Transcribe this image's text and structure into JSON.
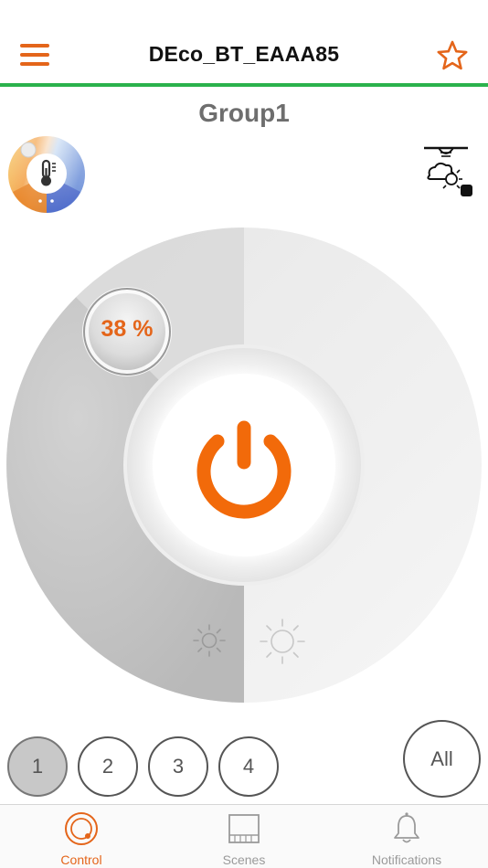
{
  "header": {
    "title": "DEco_BT_EAAA85",
    "menu_icon": "hamburger-menu-icon",
    "favorite_icon": "star-outline-icon",
    "accent_color": "#e4651a",
    "divider_color": "#2bb24c"
  },
  "group": {
    "name": "Group1"
  },
  "controls": {
    "color_temp_icon": "thermometer-icon",
    "sensor_icon": "daylight-sensor-icon"
  },
  "dial": {
    "level_label": "38 %",
    "level_percent": 38,
    "power_icon": "power-icon",
    "dim_icon": "sun-small-icon",
    "bright_icon": "sun-large-icon"
  },
  "channels": {
    "items": [
      "1",
      "2",
      "3",
      "4"
    ],
    "selected": "1",
    "all_label": "All"
  },
  "tabs": [
    {
      "label": "Control",
      "icon": "control-dial-icon",
      "active": true
    },
    {
      "label": "Scenes",
      "icon": "scenes-grid-icon",
      "active": false
    },
    {
      "label": "Notifications",
      "icon": "bell-icon",
      "active": false
    }
  ]
}
